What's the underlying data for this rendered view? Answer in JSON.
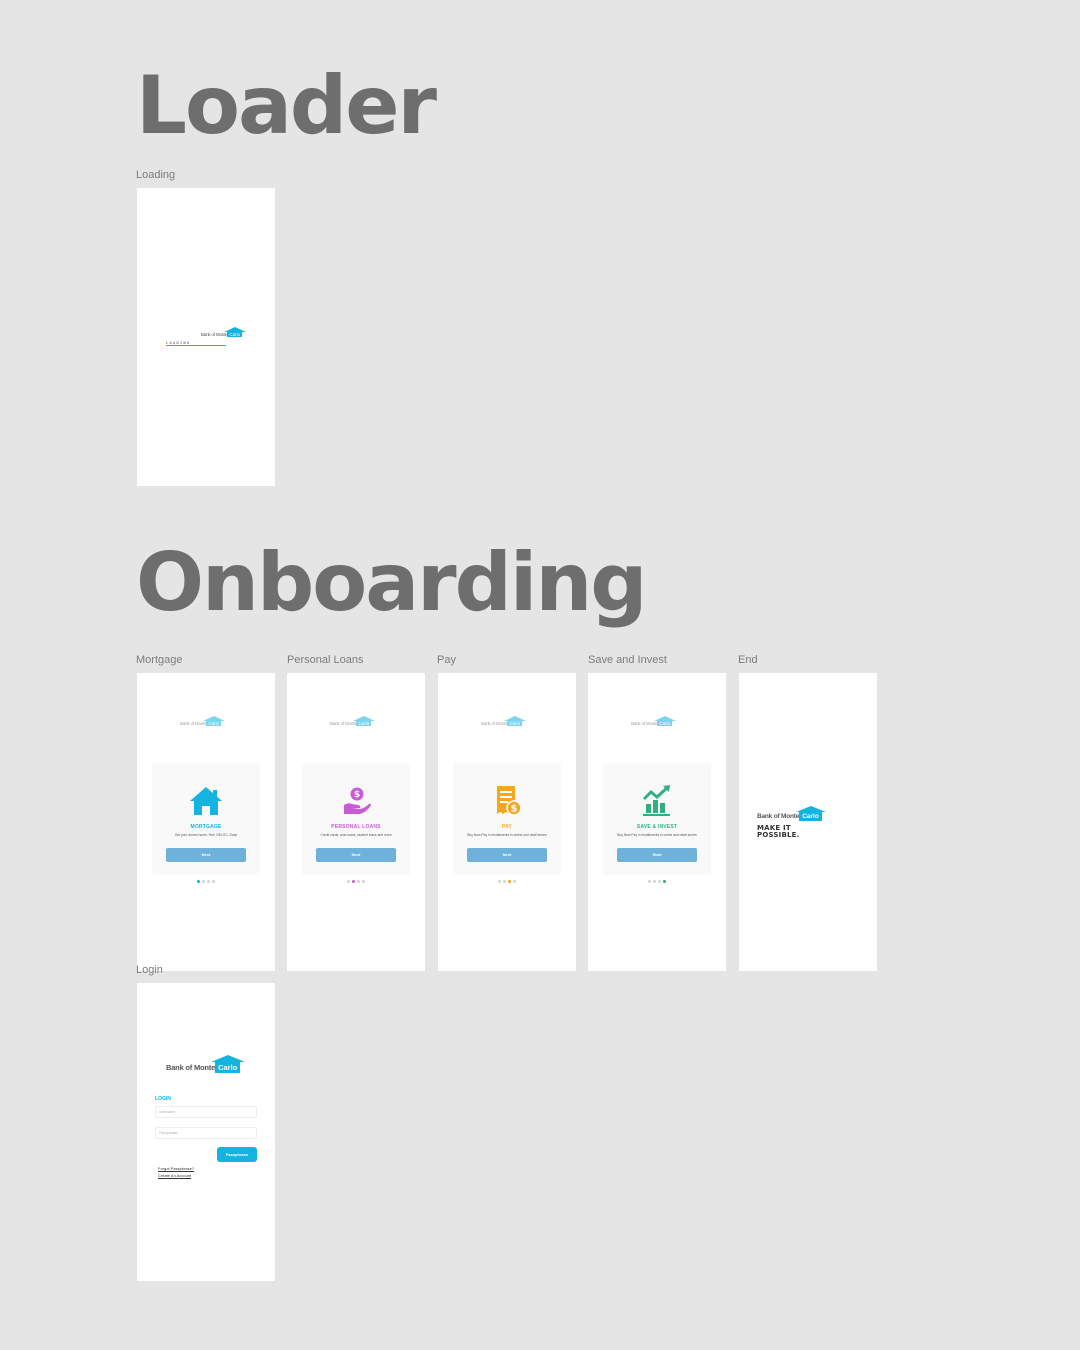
{
  "sections": {
    "loader_title": "Loader",
    "onboarding_title": "Onboarding"
  },
  "brand": {
    "bank": "Bank of Monte",
    "carlo": "Carlo",
    "tagline_line1": "MAKE IT",
    "tagline_line2": "POSSIBLE.",
    "accent": "#14b4e0"
  },
  "loader": {
    "frame_label": "Loading",
    "loading_text": "LOADING"
  },
  "onboarding": {
    "frames": [
      {
        "label": "Mortgage",
        "icon": "house-icon",
        "title": "MORTGAGE",
        "title_color": "#14b4e0",
        "description": "Get your dream home, Refi, HELOC, Solar",
        "button": "Next",
        "active_dot": 0,
        "dot_color": "#14b4e0"
      },
      {
        "label": "Personal Loans",
        "icon": "hand-coin-icon",
        "title": "PERSONAL LOANS",
        "title_color": "#c95bd6",
        "description": "Credit cards, auto loans, student loans and more",
        "button": "Next",
        "active_dot": 1,
        "dot_color": "#c95bd6"
      },
      {
        "label": "Pay",
        "icon": "receipt-dollar-icon",
        "title": "PAY",
        "title_color": "#f5a623",
        "description": "Buy Now Pay in Installments in online and retail stores",
        "button": "Next",
        "active_dot": 2,
        "dot_color": "#f5a623"
      },
      {
        "label": "Save and Invest",
        "icon": "growth-chart-icon",
        "title": "SAVE & INVEST",
        "title_color": "#2fb07e",
        "description": "Buy Now Pay in Installments in online and retail stores",
        "button": "Start",
        "active_dot": 3,
        "dot_color": "#2fb07e"
      }
    ],
    "end_label": "End"
  },
  "login": {
    "frame_label": "Login",
    "heading": "LOGIN",
    "username_placeholder": "Username",
    "passphrase_placeholder": "Passphrase",
    "button": "Passphrase",
    "forgot_link": "Forgot Passphrase?",
    "create_link": "Create An Account"
  }
}
